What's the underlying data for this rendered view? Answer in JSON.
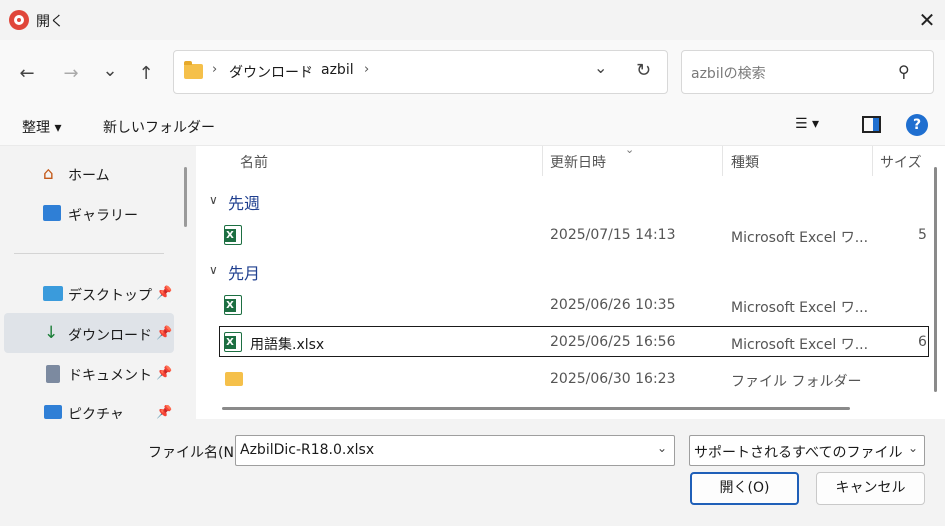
{
  "window": {
    "title": "開く",
    "close_icon": "close-icon"
  },
  "nav": {
    "back_icon": "←",
    "forward_icon": "→",
    "recent_icon": "⌄",
    "up_icon": "↑",
    "breadcrumb": [
      "ダウンロード",
      "azbil"
    ],
    "search_placeholder": "azbilの検索"
  },
  "toolbar": {
    "organize": "整理 ▾",
    "new_folder": "新しいフォルダー",
    "view_menu": "☰ ▾",
    "help": "?"
  },
  "sidebar": {
    "items": [
      {
        "label": "ホーム",
        "icon": "home-icon"
      },
      {
        "label": "ギャラリー",
        "icon": "gallery-icon"
      },
      {
        "label": "デスクトップ",
        "icon": "desktop-icon",
        "pinned": true
      },
      {
        "label": "ダウンロード",
        "icon": "download-icon",
        "pinned": true,
        "selected": true
      },
      {
        "label": "ドキュメント",
        "icon": "document-icon",
        "pinned": true
      },
      {
        "label": "ピクチャ",
        "icon": "picture-icon",
        "pinned": true
      }
    ]
  },
  "columns": {
    "name": "名前",
    "date": "更新日時",
    "type": "種類",
    "size": "サイズ"
  },
  "groups": [
    {
      "label": "先週",
      "files": [
        {
          "name": "",
          "icon": "excel-icon",
          "date": "2025/07/15 14:13",
          "type": "Microsoft Excel ワ...",
          "size": "5"
        }
      ]
    },
    {
      "label": "先月",
      "files": [
        {
          "name": "",
          "icon": "excel-icon",
          "date": "2025/06/26 10:35",
          "type": "Microsoft Excel ワ...",
          "size": ""
        },
        {
          "name": "用語集.xlsx",
          "icon": "excel-icon",
          "date": "2025/06/25 16:56",
          "type": "Microsoft Excel ワ...",
          "size": "6",
          "selected": true
        },
        {
          "name": "",
          "icon": "folder-icon",
          "date": "2025/06/30 16:23",
          "type": "ファイル フォルダー",
          "size": ""
        }
      ]
    }
  ],
  "footer": {
    "filename_label": "ファイル名(N):",
    "filename_value": "AzbilDic-R18.0.xlsx",
    "filetype_value": "サポートされるすべてのファイル (*.csv;",
    "open_button": "開く(O)",
    "cancel_button": "キャンセル"
  }
}
